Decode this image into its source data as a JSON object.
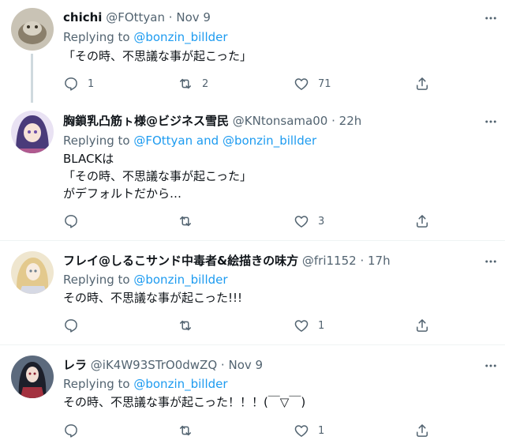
{
  "icons": {
    "reply": "reply-icon",
    "retweet": "retweet-icon",
    "like": "like-icon",
    "share": "share-icon",
    "more": "more-icon"
  },
  "colors": {
    "link": "#1d9bf0",
    "secondary": "#536471",
    "text": "#0f1419"
  },
  "tweets": [
    {
      "name": "chichi",
      "handle": "@FOttyan",
      "dot": "·",
      "time": "Nov 9",
      "replying_prefix": "Replying to",
      "mention_1": "@bonzin_billder",
      "text": "「その時、不思議な事が起こった」",
      "reply_count": "1",
      "retweet_count": "2",
      "like_count": "71"
    },
    {
      "name": "胸鎖乳凸筋ㇳ様@ビジネス雪民",
      "handle": "@KNtonsama00",
      "dot": "·",
      "time": "22h",
      "replying_prefix": "Replying to",
      "mention_1": "@FOttyan",
      "joiner": "and",
      "mention_2": "@bonzin_billder",
      "text": "BLACKは\n「その時、不思議な事が起こった」\nがデフォルトだから…",
      "like_count": "3"
    },
    {
      "name": "フレイ@しるこサンド中毒者&絵描きの味方",
      "handle": "@fri1152",
      "dot": "·",
      "time": "17h",
      "replying_prefix": "Replying to",
      "mention_1": "@bonzin_billder",
      "text": "その時、不思議な事が起こった!!!",
      "like_count": "1"
    },
    {
      "name": "レラ",
      "handle": "@iK4W93STrO0dwZQ",
      "dot": "·",
      "time": "Nov 9",
      "replying_prefix": "Replying to",
      "mention_1": "@bonzin_billder",
      "text": "その時、不思議な事が起こった！！！(￣▽￣)",
      "like_count": "1"
    }
  ]
}
